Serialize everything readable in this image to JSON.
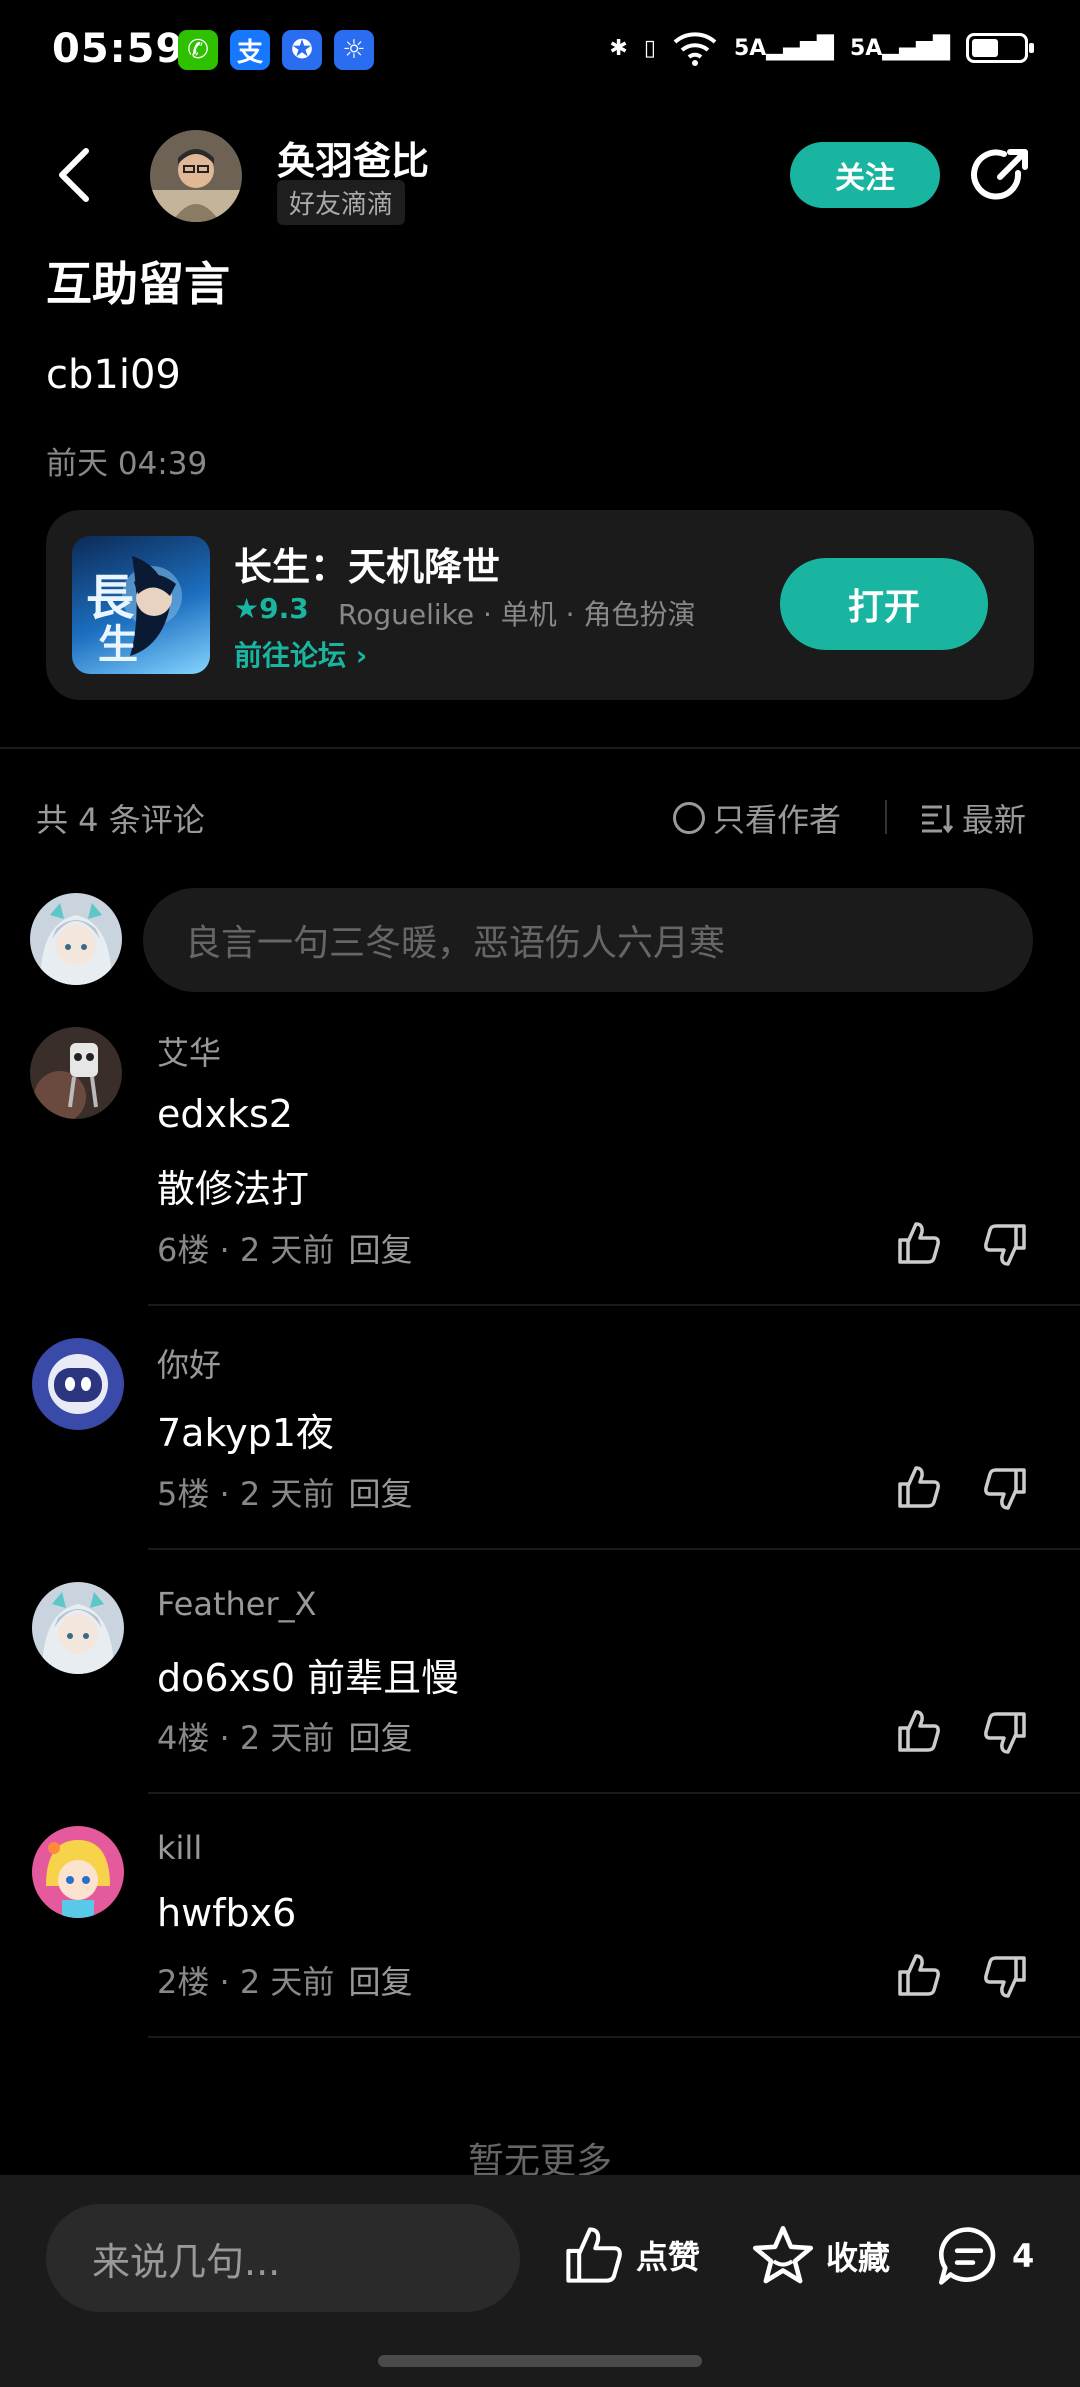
{
  "status_bar": {
    "time": "05:59",
    "net1": "5A",
    "net2": "5A",
    "app_icons": [
      {
        "name": "wechat-icon",
        "glyph": "✆",
        "color": "#2dc100"
      },
      {
        "name": "alipay-icon",
        "glyph": "支",
        "color": "#1677ff"
      },
      {
        "name": "shield-app-icon",
        "glyph": "✪",
        "color": "#2b6df0"
      },
      {
        "name": "bulb-app-icon",
        "glyph": "☼",
        "color": "#2b6df0"
      }
    ]
  },
  "header": {
    "author_name": "奂羽爸比",
    "author_tag": "好友滴滴",
    "follow_label": "关注"
  },
  "post": {
    "title": "互助留言",
    "body": "cb1i09",
    "time": "前天 04:39"
  },
  "game_card": {
    "name": "长生：天机降世",
    "rating": "★9.3",
    "tags": "Roguelike · 单机 · 角色扮演",
    "forum_link": "前往论坛 ›",
    "open_label": "打开"
  },
  "comments_header": {
    "count": "共 4 条评论",
    "only_author": "只看作者",
    "sort": "最新"
  },
  "my_input": {
    "placeholder": "良言一句三冬暖，恶语伤人六月寒"
  },
  "comments": [
    {
      "user": "艾华",
      "lines": [
        "edxks2",
        "散修法打"
      ],
      "floor": "6楼",
      "ago": "2 天前",
      "reply": "回复"
    },
    {
      "user": "你好",
      "lines": [
        "7akyp1夜"
      ],
      "floor": "5楼",
      "ago": "2 天前",
      "reply": "回复"
    },
    {
      "user": "Feather_X",
      "lines": [
        "do6xs0  前辈且慢"
      ],
      "floor": "4楼",
      "ago": "2 天前",
      "reply": "回复"
    },
    {
      "user": "kill",
      "lines": [
        "hwfbx6"
      ],
      "floor": "2楼",
      "ago": "2 天前",
      "reply": "回复"
    }
  ],
  "no_more": "暂无更多",
  "bottom_bar": {
    "input_placeholder": "来说几句...",
    "like_label": "点赞",
    "fav_label": "收藏",
    "comment_count": "4"
  },
  "colors": {
    "accent": "#19b5a0",
    "background": "#000000",
    "card": "#1b1b1b"
  }
}
